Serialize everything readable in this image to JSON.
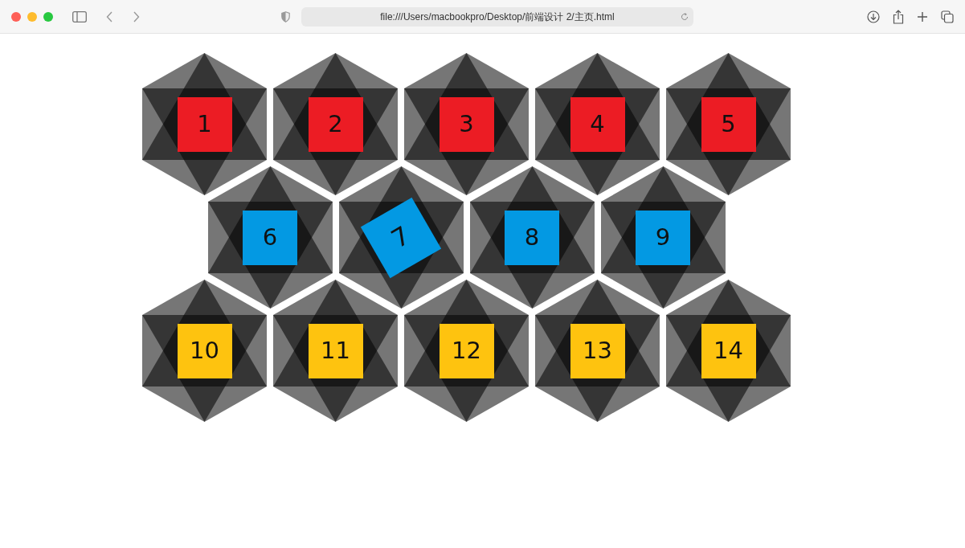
{
  "browser": {
    "url": "file:///Users/macbookpro/Desktop/前端设计 2/主页.html"
  },
  "rows": [
    {
      "tiles": [
        {
          "label": "1",
          "color": "#ec1c24",
          "hovered": false
        },
        {
          "label": "2",
          "color": "#ec1c24",
          "hovered": false
        },
        {
          "label": "3",
          "color": "#ec1c24",
          "hovered": false
        },
        {
          "label": "4",
          "color": "#ec1c24",
          "hovered": false
        },
        {
          "label": "5",
          "color": "#ec1c24",
          "hovered": false
        }
      ]
    },
    {
      "tiles": [
        {
          "label": "6",
          "color": "#0399e3",
          "hovered": false
        },
        {
          "label": "7",
          "color": "#0399e3",
          "hovered": true
        },
        {
          "label": "8",
          "color": "#0399e3",
          "hovered": false
        },
        {
          "label": "9",
          "color": "#0399e3",
          "hovered": false
        }
      ]
    },
    {
      "tiles": [
        {
          "label": "10",
          "color": "#fec30f",
          "hovered": false
        },
        {
          "label": "11",
          "color": "#fec30f",
          "hovered": false
        },
        {
          "label": "12",
          "color": "#fec30f",
          "hovered": false
        },
        {
          "label": "13",
          "color": "#fec30f",
          "hovered": false
        },
        {
          "label": "14",
          "color": "#fec30f",
          "hovered": false
        }
      ]
    }
  ]
}
